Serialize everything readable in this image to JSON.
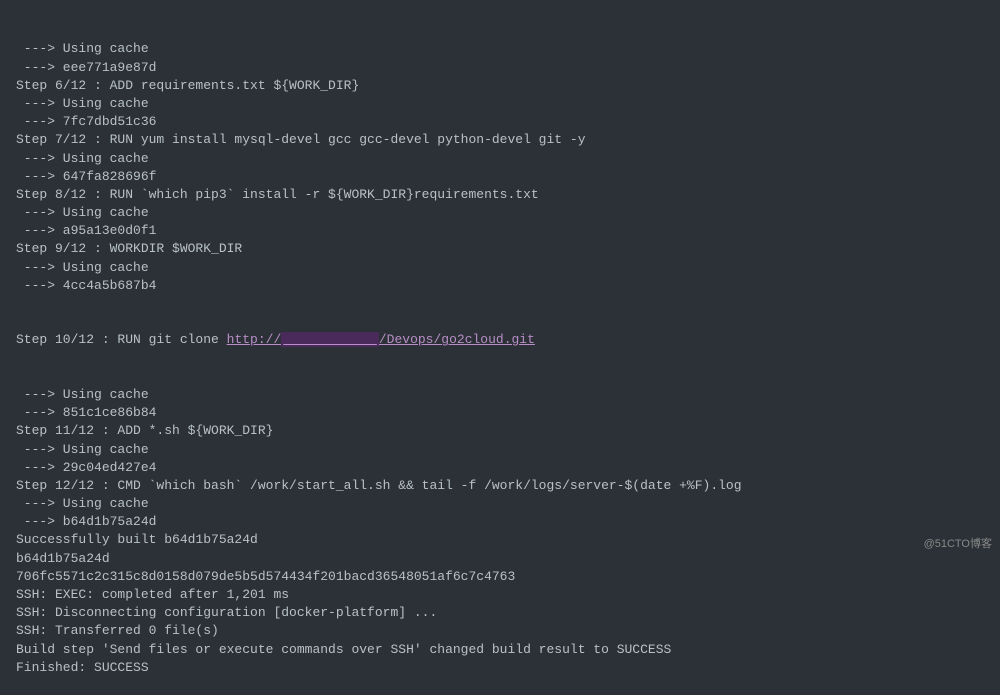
{
  "lines": [
    " ---> Using cache",
    " ---> eee771a9e87d",
    "Step 6/12 : ADD requirements.txt ${WORK_DIR}",
    " ---> Using cache",
    " ---> 7fc7dbd51c36",
    "Step 7/12 : RUN yum install mysql-devel gcc gcc-devel python-devel git -y",
    " ---> Using cache",
    " ---> 647fa828696f",
    "Step 8/12 : RUN `which pip3` install -r ${WORK_DIR}requirements.txt",
    " ---> Using cache",
    " ---> a95a13e0d0f1",
    "Step 9/12 : WORKDIR $WORK_DIR",
    " ---> Using cache",
    " ---> 4cc4a5b687b4"
  ],
  "link_line": {
    "prefix": "Step 10/12 : RUN git clone ",
    "url_visible": "http://",
    "url_redacted": "            ",
    "url_suffix": "/Devops/go2cloud.git"
  },
  "lines_after": [
    " ---> Using cache",
    " ---> 851c1ce86b84",
    "Step 11/12 : ADD *.sh ${WORK_DIR}",
    " ---> Using cache",
    " ---> 29c04ed427e4",
    "Step 12/12 : CMD `which bash` /work/start_all.sh && tail -f /work/logs/server-$(date +%F).log",
    " ---> Using cache",
    " ---> b64d1b75a24d",
    "Successfully built b64d1b75a24d",
    "b64d1b75a24d",
    "706fc5571c2c315c8d0158d079de5b5d574434f201bacd36548051af6c7c4763",
    "SSH: EXEC: completed after 1,201 ms",
    "SSH: Disconnecting configuration [docker-platform] ...",
    "SSH: Transferred 0 file(s)",
    "Build step 'Send files or execute commands over SSH' changed build result to SUCCESS",
    "Finished: SUCCESS"
  ],
  "watermark": "@51CTO博客"
}
